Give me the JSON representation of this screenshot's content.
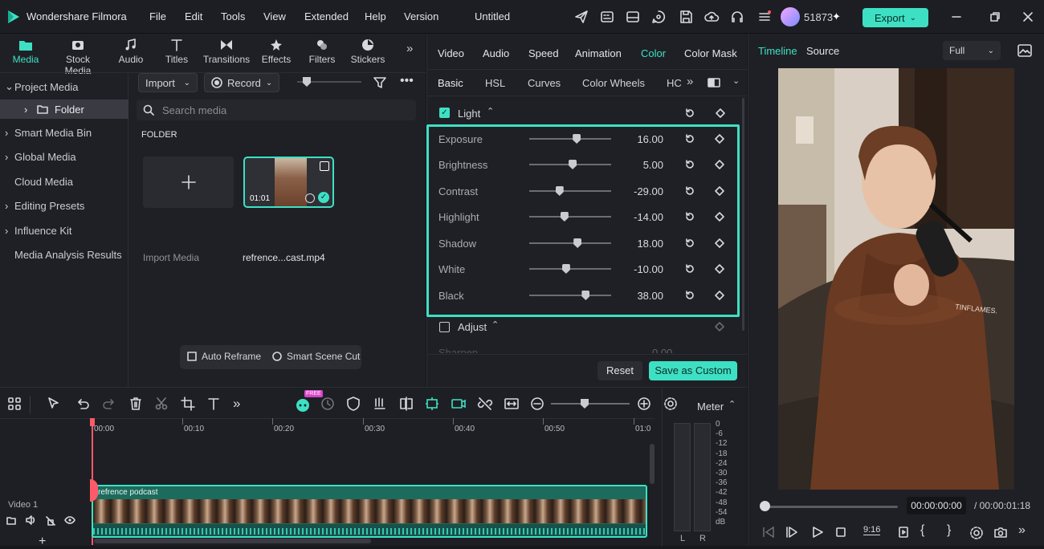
{
  "app": {
    "name": "Wondershare Filmora",
    "project": "Untitled",
    "user_id": "51873",
    "export_label": "Export"
  },
  "menu": [
    "File",
    "Edit",
    "Tools",
    "View",
    "Extended",
    "Help",
    "Version"
  ],
  "media_tabs": [
    "Media",
    "Stock Media",
    "Audio",
    "Titles",
    "Transitions",
    "Effects",
    "Filters",
    "Stickers"
  ],
  "tree": [
    {
      "label": "Project Media",
      "arrow": "⌄"
    },
    {
      "label": "Folder",
      "arrow": "›"
    },
    {
      "label": "Smart Media Bin",
      "arrow": "›"
    },
    {
      "label": "Global Media",
      "arrow": "›"
    },
    {
      "label": "Cloud Media",
      "arrow": ""
    },
    {
      "label": "Editing Presets",
      "arrow": "›"
    },
    {
      "label": "Influence Kit",
      "arrow": "›"
    },
    {
      "label": "Media Analysis Results",
      "arrow": ""
    }
  ],
  "media": {
    "import_label": "Import",
    "record_label": "Record",
    "search_placeholder": "Search media",
    "folder_heading": "FOLDER",
    "import_media_label": "Import Media",
    "clip_name": "refrence...cast.mp4",
    "clip_duration": "01:01",
    "auto_reframe": "Auto Reframe",
    "smart_scene_cut": "Smart Scene Cut"
  },
  "settings": {
    "tabs": [
      "Video",
      "Audio",
      "Speed",
      "Animation",
      "Color",
      "Color Mask"
    ],
    "active_tab": "Color",
    "subtabs": [
      "Basic",
      "HSL",
      "Curves",
      "Color Wheels",
      "HC"
    ],
    "light_label": "Light",
    "adjust_label": "Adjust",
    "sharpen_label": "Sharpen",
    "sharpen_value": "0.00",
    "rows": [
      {
        "label": "Exposure",
        "value": "16.00",
        "pos": 0.58
      },
      {
        "label": "Brightness",
        "value": "5.00",
        "pos": 0.53
      },
      {
        "label": "Contrast",
        "value": "-29.00",
        "pos": 0.37
      },
      {
        "label": "Highlight",
        "value": "-14.00",
        "pos": 0.43
      },
      {
        "label": "Shadow",
        "value": "18.00",
        "pos": 0.59
      },
      {
        "label": "White",
        "value": "-10.00",
        "pos": 0.45
      },
      {
        "label": "Black",
        "value": "38.00",
        "pos": 0.69
      }
    ],
    "reset_label": "Reset",
    "save_custom_label": "Save as Custom"
  },
  "preview": {
    "tabs": [
      "Timeline",
      "Source"
    ],
    "zoom": "Full",
    "current_time": "00:00:00:00",
    "total_time": "/ 00:00:01:18",
    "hoodie_text": "TINFLAMES."
  },
  "timeline": {
    "ruler": [
      "00:00",
      "00:10",
      "00:20",
      "00:30",
      "00:40",
      "00:50",
      "01:0"
    ],
    "track_label": "Video 1",
    "clip_title": "refrence podcast",
    "meter_label": "Meter",
    "meter_scale": [
      "0",
      "-6",
      "-12",
      "-18",
      "-24",
      "-30",
      "-36",
      "-42",
      "-48",
      "-54",
      "dB"
    ],
    "meter_channels": [
      "L",
      "R"
    ],
    "badge": "FREE"
  },
  "colors": {
    "accent": "#3ee0c4"
  }
}
